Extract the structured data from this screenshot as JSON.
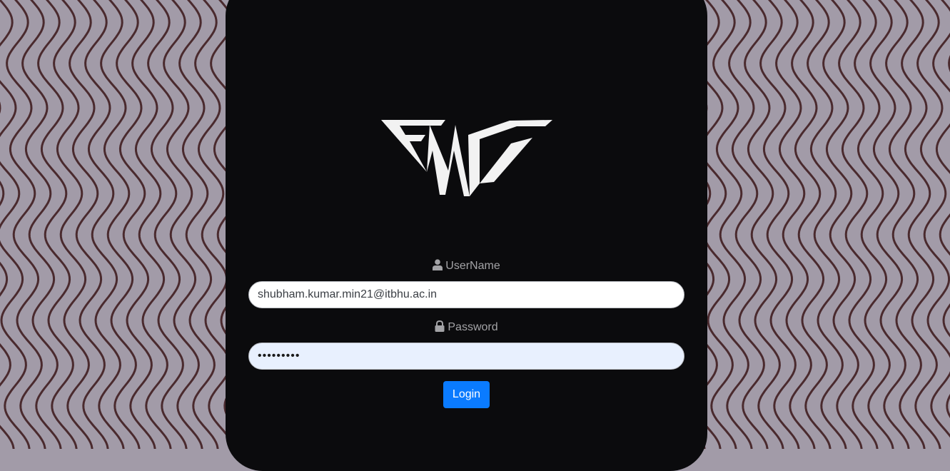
{
  "theme": {
    "background": "#a29ba8",
    "pattern_line": "#4a2a2e",
    "card": "#0b0b0d",
    "label": "#a3a3a6",
    "accent": "#0a7bff"
  },
  "logo": {
    "text": "FMC",
    "icon": "fmc-logo"
  },
  "username": {
    "label": "UserName",
    "icon": "user-icon",
    "value": "shubham.kumar.min21@itbhu.ac.in"
  },
  "password": {
    "label": "Password",
    "icon": "lock-icon",
    "value": "•••••••••"
  },
  "login": {
    "label": "Login"
  }
}
